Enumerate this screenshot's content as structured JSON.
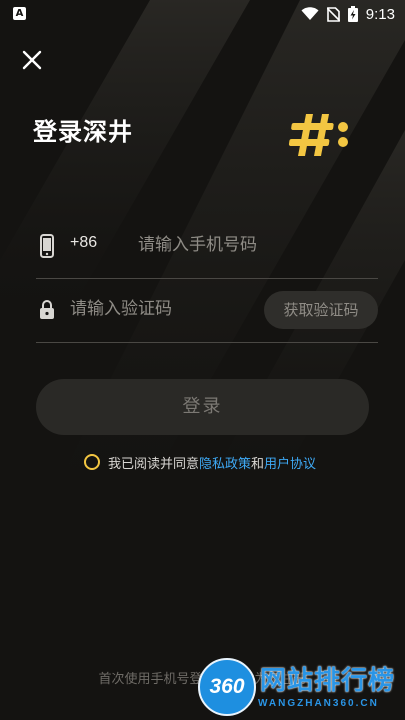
{
  "status_bar": {
    "app_icon": "A",
    "time": "9:13",
    "icons": [
      "wifi-icon",
      "no-sim-icon",
      "battery-charging-icon"
    ]
  },
  "header": {
    "close_icon": "close-icon",
    "title": "登录深井",
    "logo_icon": "hash-logo-icon"
  },
  "phone_field": {
    "icon": "phone-icon",
    "country_code": "+86",
    "placeholder": "请输入手机号码",
    "value": ""
  },
  "code_field": {
    "icon": "lock-icon",
    "placeholder": "请输入验证码",
    "value": "",
    "get_code_label": "获取验证码"
  },
  "login_button": {
    "label": "登录"
  },
  "agreement": {
    "prefix": "我已阅读并同意",
    "privacy_link": "隐私政策",
    "conjunction": "和",
    "terms_link": "用户协议",
    "checked": false
  },
  "footer": {
    "note": "首次使用手机号登录将自动为您注册"
  },
  "watermark": {
    "badge": "360",
    "text": "网站排行榜",
    "sub": "WANGZHAN360.CN"
  },
  "colors": {
    "background": "#141311",
    "accent": "#f3c642",
    "link": "#3ea9f5"
  }
}
